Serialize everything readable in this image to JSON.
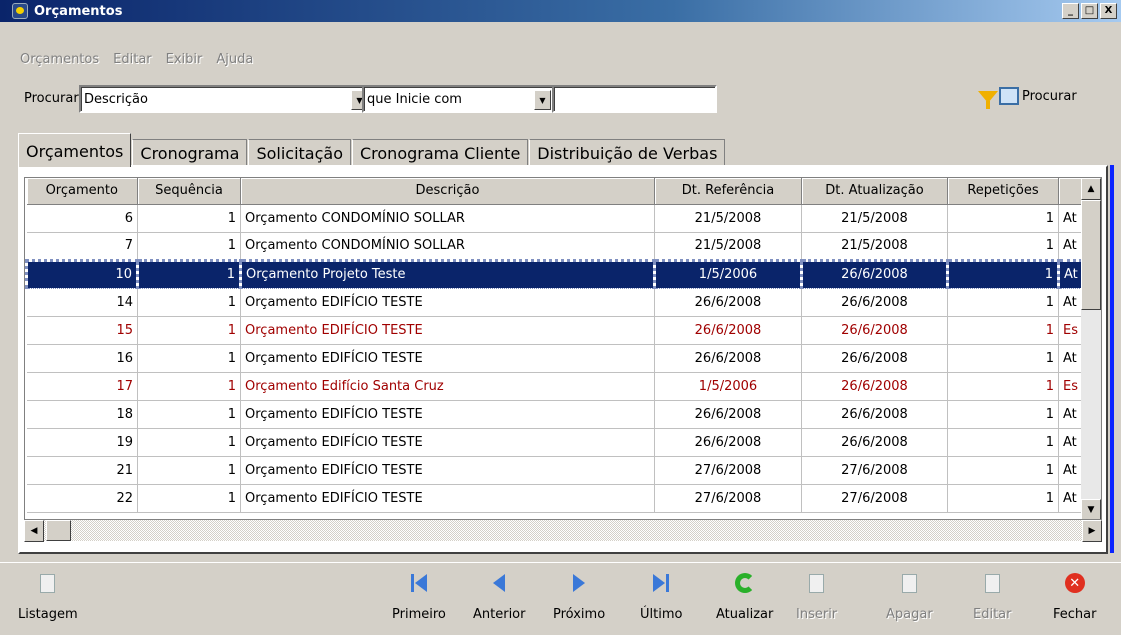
{
  "window": {
    "title": "Orçamentos",
    "minimize": "_",
    "maximize": "□",
    "close": "X"
  },
  "menu": [
    "Orçamentos",
    "Editar",
    "Exibir",
    "Ajuda"
  ],
  "search": {
    "label": "Procurar",
    "field": "Descrição",
    "operator": "que Inicie com",
    "value": "",
    "button": "Procurar"
  },
  "tabs": [
    "Orçamentos",
    "Cronograma",
    "Solicitação",
    "Cronograma Cliente",
    "Distribuição de Verbas"
  ],
  "grid": {
    "columns": [
      "Orçamento",
      "Sequência",
      "Descrição",
      "Dt. Referência",
      "Dt. Atualização",
      "Repetições",
      ""
    ],
    "rows": [
      {
        "orc": "6",
        "seq": "1",
        "desc": "Orçamento CONDOMÍNIO SOLLAR",
        "ref": "21/5/2008",
        "atual": "21/5/2008",
        "rep": "1",
        "extra": "At",
        "state": "normal"
      },
      {
        "orc": "7",
        "seq": "1",
        "desc": "Orçamento CONDOMÍNIO SOLLAR",
        "ref": "21/5/2008",
        "atual": "21/5/2008",
        "rep": "1",
        "extra": "At",
        "state": "normal"
      },
      {
        "orc": "10",
        "seq": "1",
        "desc": "Orçamento Projeto Teste",
        "ref": "1/5/2006",
        "atual": "26/6/2008",
        "rep": "1",
        "extra": "At",
        "state": "selected"
      },
      {
        "orc": "14",
        "seq": "1",
        "desc": "Orçamento EDIFÍCIO TESTE",
        "ref": "26/6/2008",
        "atual": "26/6/2008",
        "rep": "1",
        "extra": "At",
        "state": "normal"
      },
      {
        "orc": "15",
        "seq": "1",
        "desc": "Orçamento EDIFÍCIO TESTE",
        "ref": "26/6/2008",
        "atual": "26/6/2008",
        "rep": "1",
        "extra": "Es",
        "state": "red"
      },
      {
        "orc": "16",
        "seq": "1",
        "desc": "Orçamento EDIFÍCIO TESTE",
        "ref": "26/6/2008",
        "atual": "26/6/2008",
        "rep": "1",
        "extra": "At",
        "state": "normal"
      },
      {
        "orc": "17",
        "seq": "1",
        "desc": "Orçamento Edifício Santa Cruz",
        "ref": "1/5/2006",
        "atual": "26/6/2008",
        "rep": "1",
        "extra": "Es",
        "state": "red"
      },
      {
        "orc": "18",
        "seq": "1",
        "desc": "Orçamento EDIFÍCIO TESTE",
        "ref": "26/6/2008",
        "atual": "26/6/2008",
        "rep": "1",
        "extra": "At",
        "state": "normal"
      },
      {
        "orc": "19",
        "seq": "1",
        "desc": "Orçamento EDIFÍCIO TESTE",
        "ref": "26/6/2008",
        "atual": "26/6/2008",
        "rep": "1",
        "extra": "At",
        "state": "normal"
      },
      {
        "orc": "21",
        "seq": "1",
        "desc": "Orçamento EDIFÍCIO TESTE",
        "ref": "27/6/2008",
        "atual": "27/6/2008",
        "rep": "1",
        "extra": "At",
        "state": "normal"
      },
      {
        "orc": "22",
        "seq": "1",
        "desc": "Orçamento EDIFÍCIO TESTE",
        "ref": "27/6/2008",
        "atual": "27/6/2008",
        "rep": "1",
        "extra": "At",
        "state": "normal"
      }
    ]
  },
  "toolbar": {
    "listagem": "Listagem",
    "primeiro": "Primeiro",
    "anterior": "Anterior",
    "proximo": "Próximo",
    "ultimo": "Último",
    "atualizar": "Atualizar",
    "inserir": "Inserir",
    "apagar": "Apagar",
    "editar": "Editar",
    "fechar": "Fechar"
  },
  "colors": {
    "selection": "#0a246a",
    "alert_row": "#a00000",
    "nav_icon": "#3a78d8",
    "refresh_icon": "#2ab02a",
    "close_icon": "#e03020"
  }
}
